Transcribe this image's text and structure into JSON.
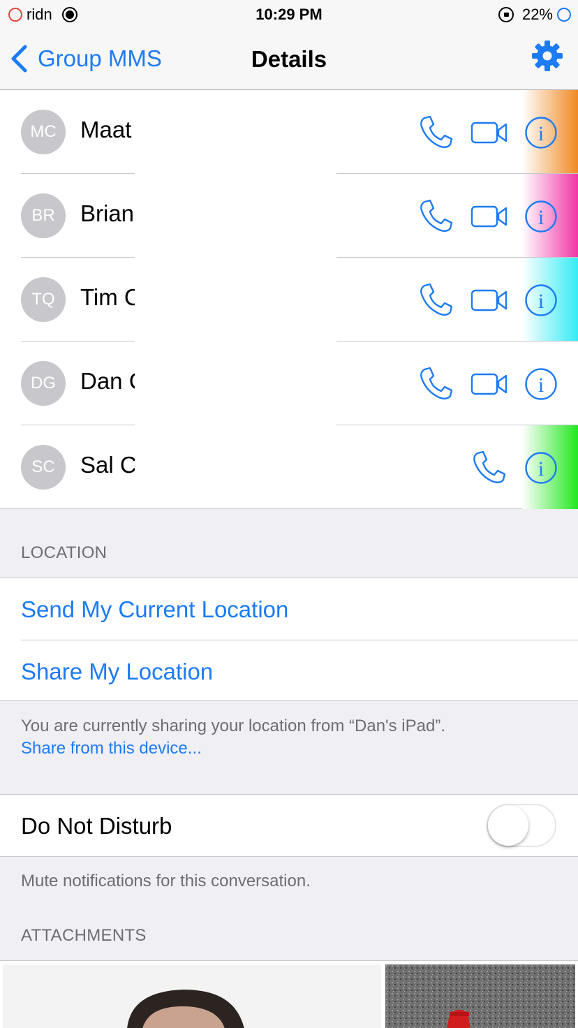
{
  "status_bar": {
    "carrier": "ridn",
    "time": "10:29 PM",
    "battery": "22%"
  },
  "nav": {
    "back_label": "Group MMS",
    "title": "Details"
  },
  "contacts": [
    {
      "initials": "MC",
      "name": "Maat",
      "has_video": true,
      "tint": "#f08a24"
    },
    {
      "initials": "BR",
      "name": "Brian",
      "has_video": true,
      "tint": "#f236a6"
    },
    {
      "initials": "TQ",
      "name": "Tim C",
      "has_video": true,
      "tint": "#35ecf4"
    },
    {
      "initials": "DG",
      "name": "Dan C",
      "has_video": true,
      "tint": ""
    },
    {
      "initials": "SC",
      "name": "Sal C",
      "has_video": false,
      "tint": "#22e81e"
    }
  ],
  "location": {
    "header": "LOCATION",
    "send_current": "Send My Current Location",
    "share": "Share My Location",
    "footer": "You are currently sharing your location from “Dan's iPad”.",
    "footer_link": "Share from this device..."
  },
  "dnd": {
    "label": "Do Not Disturb",
    "enabled": false,
    "footer": "Mute notifications for this conversation."
  },
  "attachments": {
    "header": "ATTACHMENTS"
  },
  "colors": {
    "accent": "#1d7bf5",
    "avatar_bg": "#c7c7cc",
    "group_bg": "#efeff4"
  },
  "icons": [
    "back-chevron-icon",
    "gear-icon",
    "phone-icon",
    "video-icon",
    "info-icon"
  ]
}
